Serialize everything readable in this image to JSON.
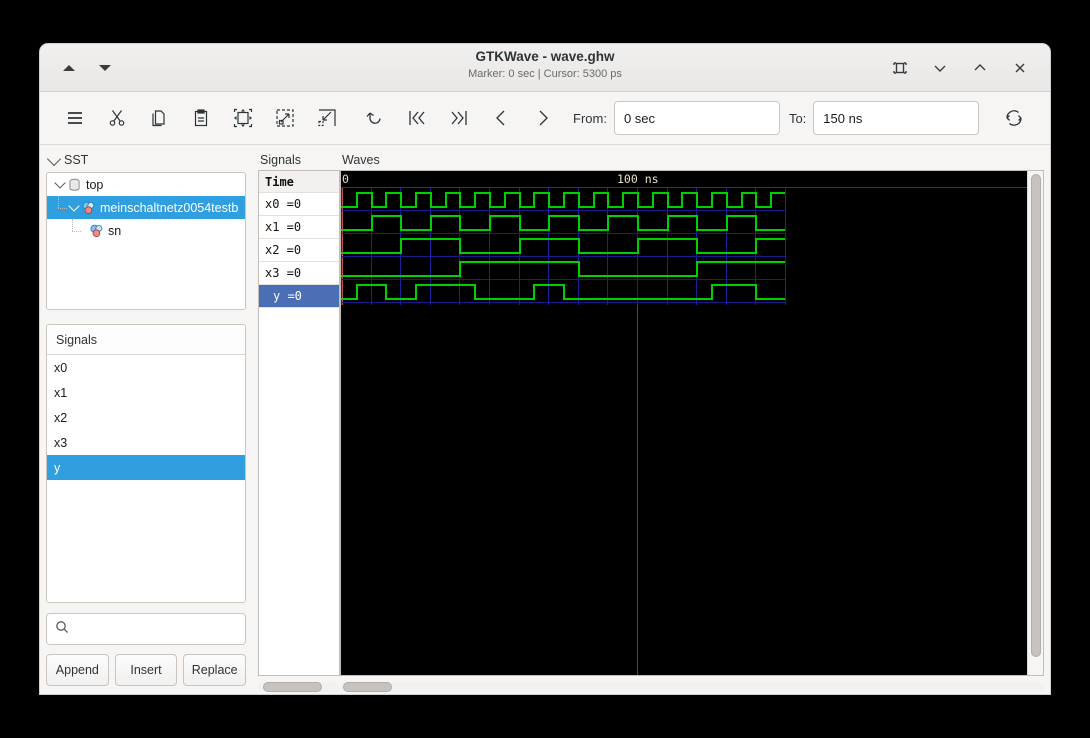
{
  "window": {
    "title": "GTKWave - wave.ghw",
    "subtitle": "Marker: 0 sec  |  Cursor: 5300 ps",
    "titlebar_buttons": {
      "prev_label": "▲",
      "next_label": "▼",
      "fullscreen": "fullscreen-icon",
      "minimize": "chevron-down-icon",
      "maximize": "chevron-up-icon",
      "close": "close-icon"
    }
  },
  "toolbar": {
    "icons": [
      "menu-icon",
      "cut-icon",
      "copy-icon",
      "paste-icon",
      "zoom-fit-icon",
      "zoom-in-icon",
      "zoom-out-icon",
      "undo-icon",
      "go-to-start-icon",
      "go-to-end-icon",
      "previous-edge-icon",
      "next-edge-icon"
    ],
    "from_label": "From:",
    "from_value": "0 sec",
    "to_label": "To:",
    "to_value": "150 ns",
    "reload_icon": "reload-icon"
  },
  "sst": {
    "header_label": "SST",
    "tree": [
      {
        "label": "top",
        "depth": 0,
        "icon": "module-icon",
        "expanded": true,
        "selected": false
      },
      {
        "label": "meinschaltnetz0054testb",
        "depth": 1,
        "icon": "instance-icon",
        "expanded": true,
        "selected": true
      },
      {
        "label": "sn",
        "depth": 2,
        "icon": "instance-icon",
        "expanded": false,
        "selected": false
      }
    ]
  },
  "signals_panel": {
    "header_label": "Signals",
    "items": [
      {
        "label": "x0",
        "selected": false
      },
      {
        "label": "x1",
        "selected": false
      },
      {
        "label": "x2",
        "selected": false
      },
      {
        "label": "x3",
        "selected": false
      },
      {
        "label": "y",
        "selected": true
      }
    ],
    "search_placeholder": "",
    "search_value": "",
    "search_icon": "search-icon",
    "buttons": [
      {
        "label": "Append"
      },
      {
        "label": "Insert"
      },
      {
        "label": "Replace"
      }
    ]
  },
  "wave_names_panel": {
    "title": "Signals",
    "time_label": "Time",
    "rows": [
      {
        "label": "x0 =0",
        "selected": false
      },
      {
        "label": "x1 =0",
        "selected": false
      },
      {
        "label": "x2 =0",
        "selected": false
      },
      {
        "label": "x3 =0",
        "selected": false
      },
      {
        "label": "y =0",
        "selected": true
      }
    ]
  },
  "waves_panel": {
    "title": "Waves",
    "marker_color": "#ff6b6b",
    "cursor_color": "#3a3ad0",
    "wave_color": "#00d000",
    "grid_color": "#1e1e9e",
    "background": "#000000"
  },
  "chart_data": {
    "type": "line",
    "title": "Waves",
    "xlabel": "Time",
    "ylabel": "",
    "time_unit": "ns",
    "x_ticks": [
      {
        "value": 0,
        "label": "0",
        "px": 0
      },
      {
        "value": 100,
        "label": "100 ns",
        "px": 296
      }
    ],
    "x_range_ns": [
      0,
      150
    ],
    "visible_data_end_ns": 150,
    "grid_every_ns": 10,
    "marker_ns": 0,
    "cursor_ns": 100,
    "cursor_readout": "5300 ps",
    "series": [
      {
        "name": "x0",
        "value_label": "x0 =0",
        "current_value": 0,
        "period_ns": 10,
        "transitions_ns": [
          0,
          5,
          10,
          15,
          20,
          25,
          30,
          35,
          40,
          45,
          50,
          55,
          60,
          65,
          70,
          75,
          80,
          85,
          90,
          95,
          100,
          105,
          110,
          115,
          120,
          125,
          130,
          135,
          140,
          145
        ],
        "start_level": 0
      },
      {
        "name": "x1",
        "value_label": "x1 =0",
        "current_value": 0,
        "period_ns": 20,
        "transitions_ns": [
          0,
          10,
          20,
          30,
          40,
          50,
          60,
          70,
          80,
          90,
          100,
          110,
          120,
          130,
          140
        ],
        "start_level": 0
      },
      {
        "name": "x2",
        "value_label": "x2 =0",
        "current_value": 0,
        "period_ns": 40,
        "transitions_ns": [
          0,
          20,
          40,
          60,
          80,
          100,
          120,
          140
        ],
        "start_level": 0
      },
      {
        "name": "x3",
        "value_label": "x3 =0",
        "current_value": 0,
        "period_ns": 80,
        "transitions_ns": [
          0,
          40,
          80,
          120
        ],
        "start_level": 0
      },
      {
        "name": "y",
        "value_label": "y =0",
        "current_value": 0,
        "period_ns": 0,
        "transitions_ns": [
          0,
          5,
          15,
          25,
          45,
          65,
          75,
          125,
          140
        ],
        "start_level": 0
      }
    ]
  }
}
